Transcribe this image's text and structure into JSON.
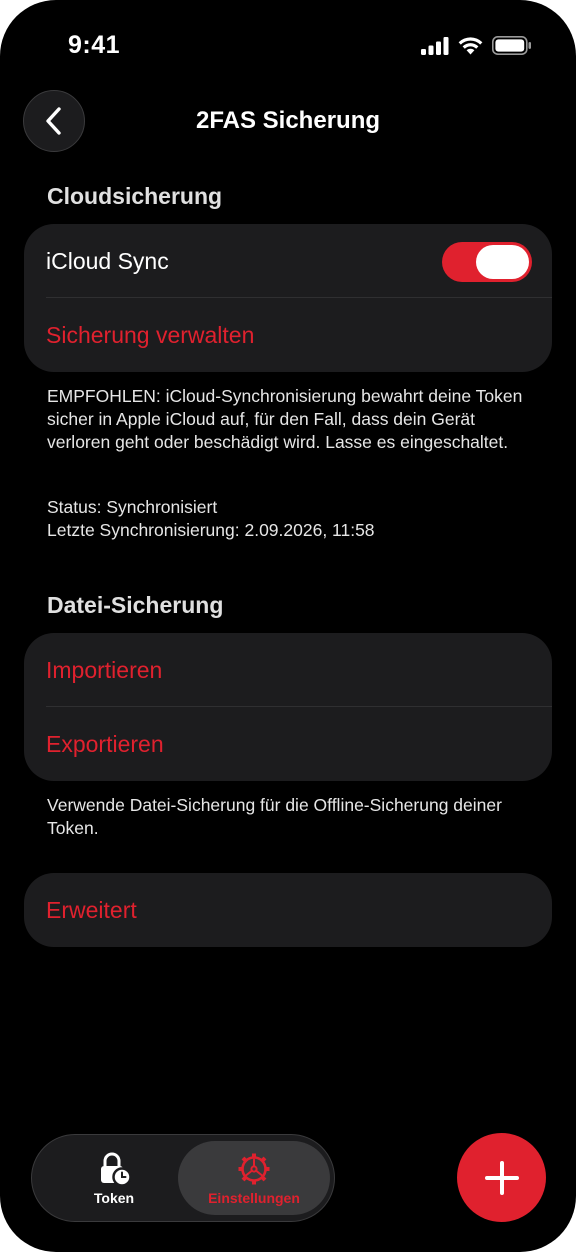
{
  "status_bar": {
    "time": "9:41"
  },
  "nav": {
    "title": "2FAS Sicherung"
  },
  "cloud": {
    "header": "Cloudsicherung",
    "icloud_sync_label": "iCloud Sync",
    "icloud_sync_on": true,
    "manage_label": "Sicherung verwalten",
    "recommended_text": "EMPFOHLEN: iCloud-Synchronisierung bewahrt deine Token sicher in Apple iCloud auf, für den Fall, dass dein Gerät verloren geht oder beschädigt wird. Lasse es eingeschaltet.",
    "status_text": "Status: Synchronisiert",
    "last_sync_text": "Letzte Synchronisierung: 2.09.2026, 11:58"
  },
  "file": {
    "header": "Datei-Sicherung",
    "import_label": "Importieren",
    "export_label": "Exportieren",
    "footer_text": "Verwende Datei-Sicherung für die Offline-Sicherung deiner Token."
  },
  "advanced": {
    "label": "Erweitert"
  },
  "tabbar": {
    "token_label": "Token",
    "settings_label": "Einstellungen",
    "token_icon": "lock-clock-icon",
    "settings_icon": "gear-icon"
  },
  "colors": {
    "accent": "#e0212e",
    "background": "#000000",
    "card": "#1c1c1e"
  }
}
